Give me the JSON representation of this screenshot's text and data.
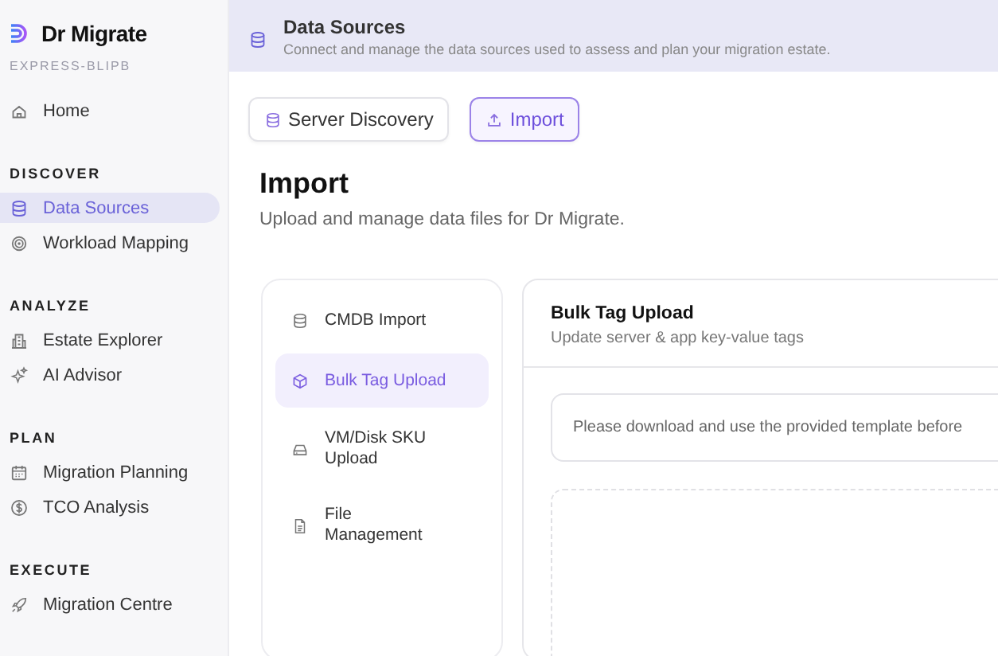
{
  "sidebar": {
    "app_name": "Dr Migrate",
    "workspace": "EXPRESS-BLIPB",
    "home": {
      "label": "Home",
      "selected": false
    },
    "sections": [
      {
        "title": "DISCOVER",
        "items": [
          {
            "label": "Data Sources",
            "selected": true
          },
          {
            "label": "Workload Mapping",
            "selected": false
          }
        ]
      },
      {
        "title": "ANALYZE",
        "items": [
          {
            "label": "Estate Explorer",
            "selected": false
          },
          {
            "label": "AI Advisor",
            "selected": false
          }
        ]
      },
      {
        "title": "PLAN",
        "items": [
          {
            "label": "Migration Planning",
            "selected": false
          },
          {
            "label": "TCO Analysis",
            "selected": false
          }
        ]
      },
      {
        "title": "EXECUTE",
        "items": [
          {
            "label": "Migration Centre",
            "selected": false
          }
        ]
      }
    ]
  },
  "header": {
    "title": "Data Sources",
    "subtitle": "Connect and manage the data sources used to assess and plan your migration estate."
  },
  "tabs": [
    {
      "label": "Server Discovery",
      "selected": false
    },
    {
      "label": "Import",
      "selected": true
    }
  ],
  "page": {
    "title": "Import",
    "subtitle": "Upload and manage data files for Dr Migrate."
  },
  "import_nav": [
    {
      "label": "CMDB Import",
      "selected": false
    },
    {
      "label": "Bulk Tag Upload",
      "selected": true
    },
    {
      "label": "VM/Disk SKU Upload",
      "selected": false
    },
    {
      "label": "File Management",
      "selected": false
    }
  ],
  "panel": {
    "title": "Bulk Tag Upload",
    "subtitle": "Update server & app key-value tags",
    "notice": "Please download and use the provided template before"
  }
}
